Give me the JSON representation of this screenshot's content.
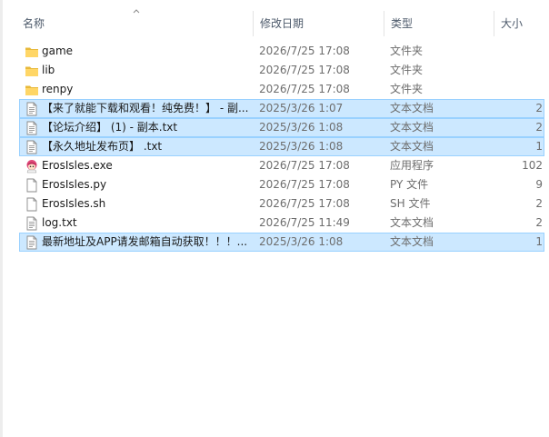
{
  "columns": {
    "name": "名称",
    "date": "修改日期",
    "type": "类型",
    "size": "大小"
  },
  "files": [
    {
      "name": "game",
      "date": "2026/7/25 17:08",
      "type": "文件夹",
      "size": "",
      "icon": "folder-icon",
      "selected": false
    },
    {
      "name": "lib",
      "date": "2026/7/25 17:08",
      "type": "文件夹",
      "size": "",
      "icon": "folder-icon",
      "selected": false
    },
    {
      "name": "renpy",
      "date": "2026/7/25 17:08",
      "type": "文件夹",
      "size": "",
      "icon": "folder-icon",
      "selected": false
    },
    {
      "name": "【来了就能下载和观看！纯免费！】 - 副...",
      "date": "2025/3/26 1:07",
      "type": "文本文档",
      "size": "2",
      "icon": "text-file-icon",
      "selected": true
    },
    {
      "name": "【论坛介绍】 (1) - 副本.txt",
      "date": "2025/3/26 1:08",
      "type": "文本文档",
      "size": "2",
      "icon": "text-file-icon",
      "selected": true
    },
    {
      "name": "【永久地址发布页】 .txt",
      "date": "2025/3/26 1:08",
      "type": "文本文档",
      "size": "1",
      "icon": "text-file-icon",
      "selected": true
    },
    {
      "name": "ErosIsles.exe",
      "date": "2026/7/25 17:08",
      "type": "应用程序",
      "size": "102",
      "icon": "app-character-icon",
      "selected": false
    },
    {
      "name": "ErosIsles.py",
      "date": "2026/7/25 17:08",
      "type": "PY 文件",
      "size": "9",
      "icon": "blank-file-icon",
      "selected": false
    },
    {
      "name": "ErosIsles.sh",
      "date": "2026/7/25 17:08",
      "type": "SH 文件",
      "size": "2",
      "icon": "blank-file-icon",
      "selected": false
    },
    {
      "name": "log.txt",
      "date": "2026/7/25 11:49",
      "type": "文本文档",
      "size": "2",
      "icon": "text-file-icon",
      "selected": false
    },
    {
      "name": "最新地址及APP请发邮箱自动获取！！！...",
      "date": "2025/3/26 1:08",
      "type": "文本文档",
      "size": "1",
      "icon": "text-file-icon",
      "selected": true
    }
  ]
}
